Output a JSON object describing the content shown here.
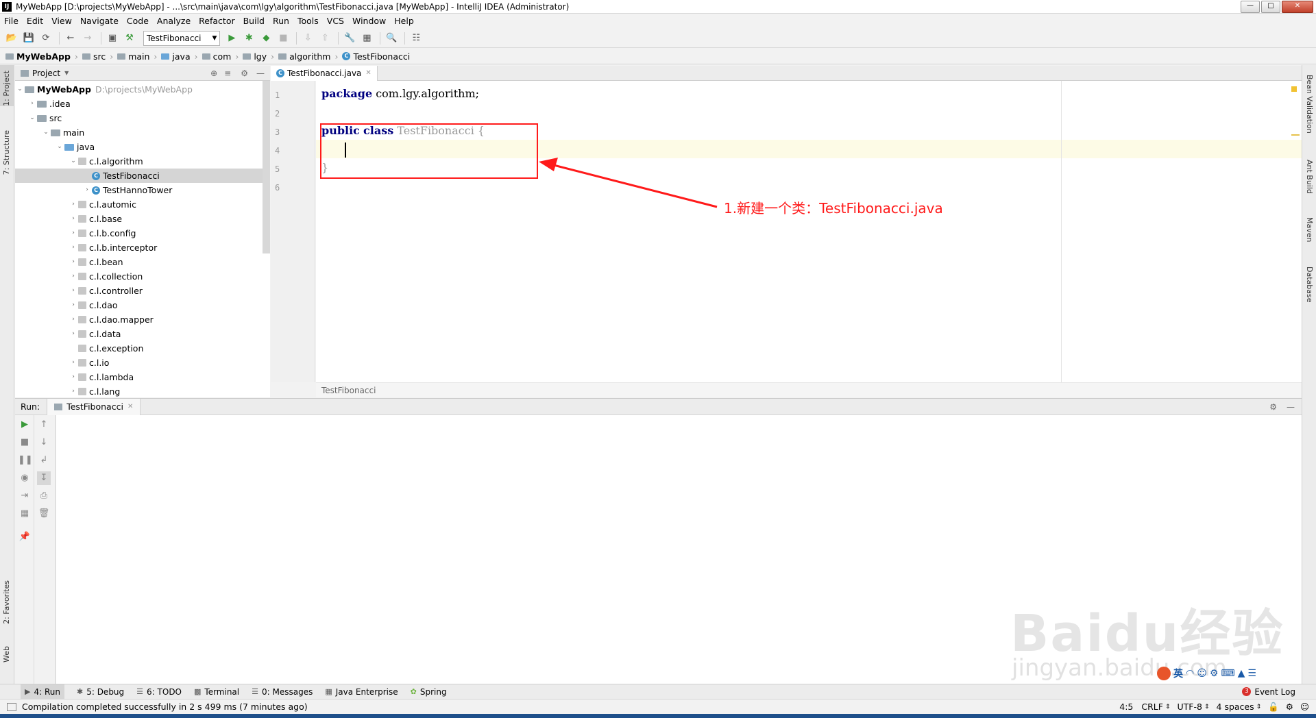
{
  "window": {
    "title": "MyWebApp [D:\\projects\\MyWebApp] - ...\\src\\main\\java\\com\\lgy\\algorithm\\TestFibonacci.java [MyWebApp] - IntelliJ IDEA (Administrator)",
    "app_icon": "IJ"
  },
  "menu": [
    "File",
    "Edit",
    "View",
    "Navigate",
    "Code",
    "Analyze",
    "Refactor",
    "Build",
    "Run",
    "Tools",
    "VCS",
    "Window",
    "Help"
  ],
  "toolbar": {
    "run_config": "TestFibonacci"
  },
  "breadcrumb": [
    "MyWebApp",
    "src",
    "main",
    "java",
    "com",
    "lgy",
    "algorithm",
    "TestFibonacci"
  ],
  "project": {
    "header": "Project",
    "root_name": "MyWebApp",
    "root_path": "D:\\projects\\MyWebApp",
    "items": [
      ".idea",
      "src",
      "main",
      "java",
      "c.l.algorithm",
      "TestFibonacci",
      "TestHannoTower",
      "c.l.automic",
      "c.l.base",
      "c.l.b.config",
      "c.l.b.interceptor",
      "c.l.bean",
      "c.l.collection",
      "c.l.controller",
      "c.l.dao",
      "c.l.dao.mapper",
      "c.l.data",
      "c.l.exception",
      "c.l.io",
      "c.l.lambda",
      "c.l.lang"
    ]
  },
  "left_strip": {
    "project": "1: Project",
    "structure": "7: Structure",
    "favorites": "2: Favorites",
    "web": "Web"
  },
  "right_strip": [
    "Bean Validation",
    "Ant Build",
    "Maven",
    "Database"
  ],
  "editor": {
    "tab": "TestFibonacci.java",
    "line_numbers": [
      "1",
      "2",
      "3",
      "4",
      "5",
      "6"
    ],
    "kw_package": "package",
    "pkg": " com.lgy.algorithm;",
    "kw_public": "public",
    "kw_class": "class",
    "class_name": "TestFibonacci",
    "open_brace": " {",
    "close_brace": "}",
    "footer_crumb": "TestFibonacci"
  },
  "annotation": {
    "text": "1.新建一个类：TestFibonacci.java",
    "color": "#ff1a1a"
  },
  "run_panel": {
    "label": "Run:",
    "tab": "TestFibonacci"
  },
  "tool_windows": [
    "4: Run",
    "5: Debug",
    "6: TODO",
    "Terminal",
    "0: Messages",
    "Java Enterprise",
    "Spring"
  ],
  "event_log": "Event Log",
  "event_count": "3",
  "status": {
    "message": "Compilation completed successfully in 2 s 499 ms (7 minutes ago)",
    "position": "4:5",
    "line_sep": "CRLF",
    "encoding": "UTF-8",
    "indent": "4 spaces"
  },
  "watermark": {
    "main": "Baidu经验",
    "sub": "jingyan.baidu.com"
  },
  "ime": {
    "lang": "英"
  },
  "colors": {
    "keyword": "#000080",
    "accent": "#3d91c9",
    "annotation": "#ff1a1a"
  }
}
